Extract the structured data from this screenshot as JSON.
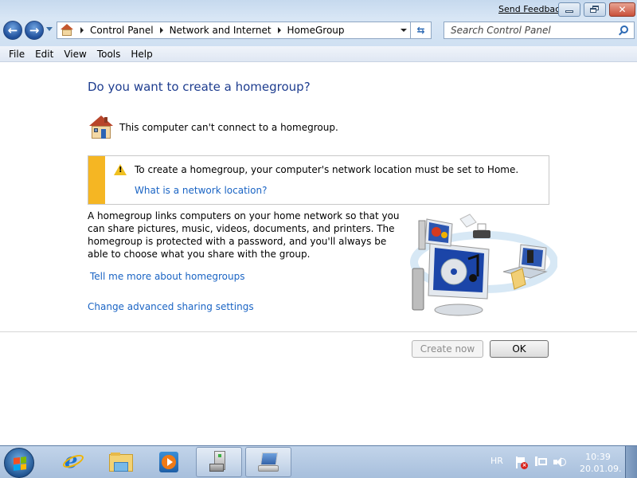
{
  "window": {
    "send_feedback": "Send Feedback",
    "controls": {
      "minimize": "minimize",
      "restore": "restore",
      "close": "✕"
    }
  },
  "nav": {
    "back_glyph": "←",
    "forward_glyph": "→",
    "breadcrumb": [
      "Control Panel",
      "Network and Internet",
      "HomeGroup"
    ],
    "refresh_glyph": "⇆"
  },
  "search": {
    "placeholder": "Search Control Panel",
    "value": ""
  },
  "menu": [
    "File",
    "Edit",
    "View",
    "Tools",
    "Help"
  ],
  "main": {
    "title": "Do you want to create a homegroup?",
    "status": "This computer can't connect to a homegroup.",
    "warning": {
      "text": "To create a homegroup, your computer's network location must be set to Home.",
      "link": "What is a network location?"
    },
    "description": "A homegroup links computers on your home network so that you can share pictures, music, videos, documents, and printers. The homegroup is protected with a password, and you'll always be able to choose what you share with the group.",
    "links": {
      "tell_more": "Tell me more about homegroups",
      "advanced_sharing": "Change advanced sharing settings"
    },
    "buttons": {
      "create_now": "Create now",
      "ok": "OK"
    }
  },
  "taskbar": {
    "items": [
      "start",
      "internet-explorer",
      "windows-explorer",
      "windows-media-player",
      "control-panel",
      "homegroup"
    ],
    "language": "HR",
    "time": "10:39",
    "date": "20.01.09."
  },
  "colors": {
    "title_blue": "#1e3d8f",
    "link_blue": "#1a64c4",
    "warning_stripe": "#f5b623"
  }
}
